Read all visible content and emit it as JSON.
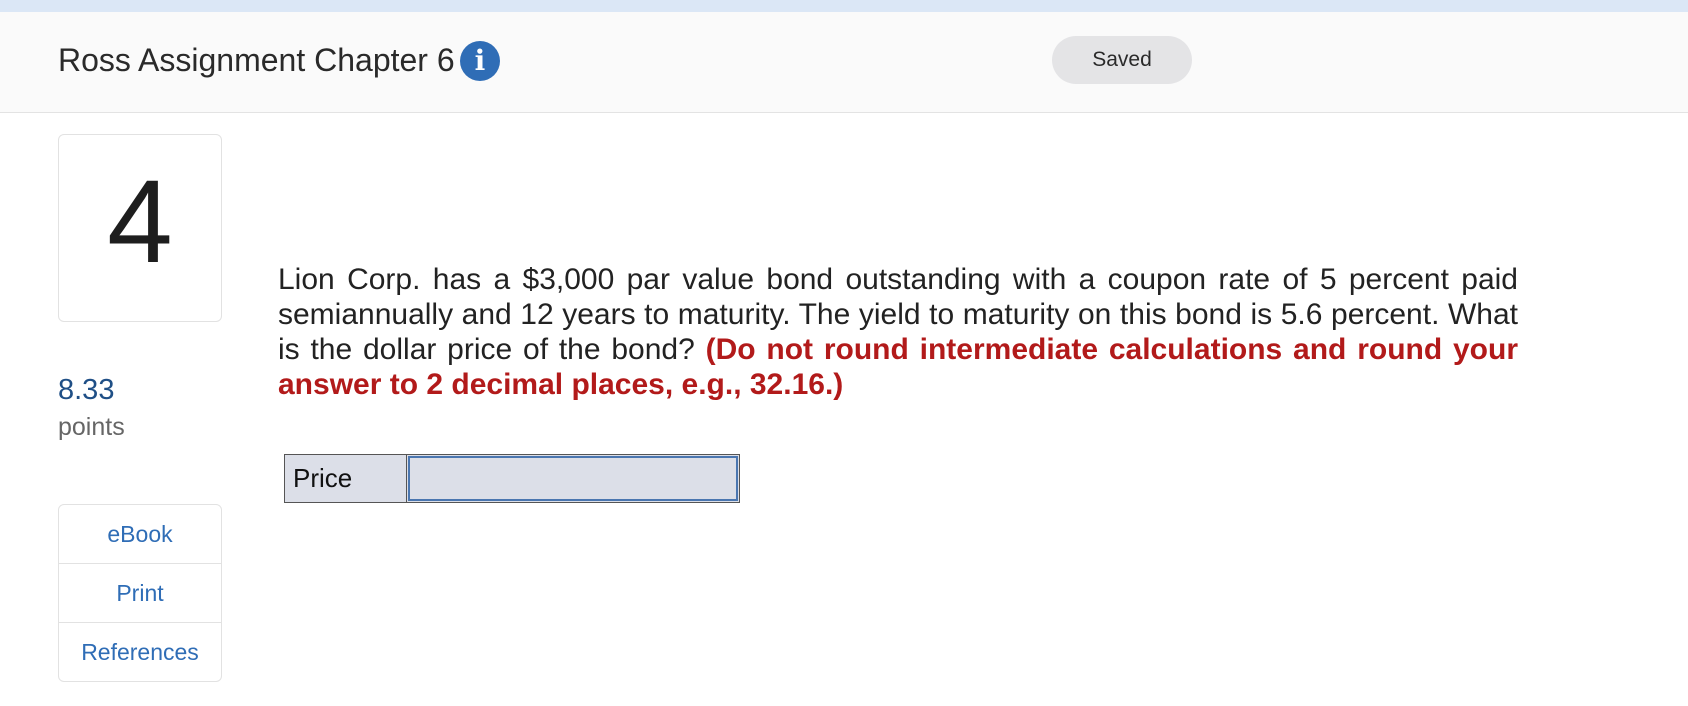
{
  "header": {
    "assignment_title": "Ross Assignment Chapter 6",
    "info_icon": "info-icon",
    "save_status": "Saved"
  },
  "question": {
    "number": "4",
    "points_value": "8.33",
    "points_label": "points",
    "text": "Lion Corp. has a $3,000 par value bond outstanding with a coupon rate of 5 percent paid semiannually and 12 years to maturity. The yield to maturity on this bond is 5.6 percent. What is the dollar price of the bond?",
    "instruction": "(Do not round intermediate calculations and round your answer to 2 decimal places, e.g., 32.16.)"
  },
  "tools": {
    "ebook": "eBook",
    "print": "Print",
    "references": "References"
  },
  "answer": {
    "label": "Price",
    "value": ""
  },
  "colors": {
    "accent": "#2f6db6",
    "instruction_red": "#b21a1a",
    "points_blue": "#1f4f86"
  }
}
